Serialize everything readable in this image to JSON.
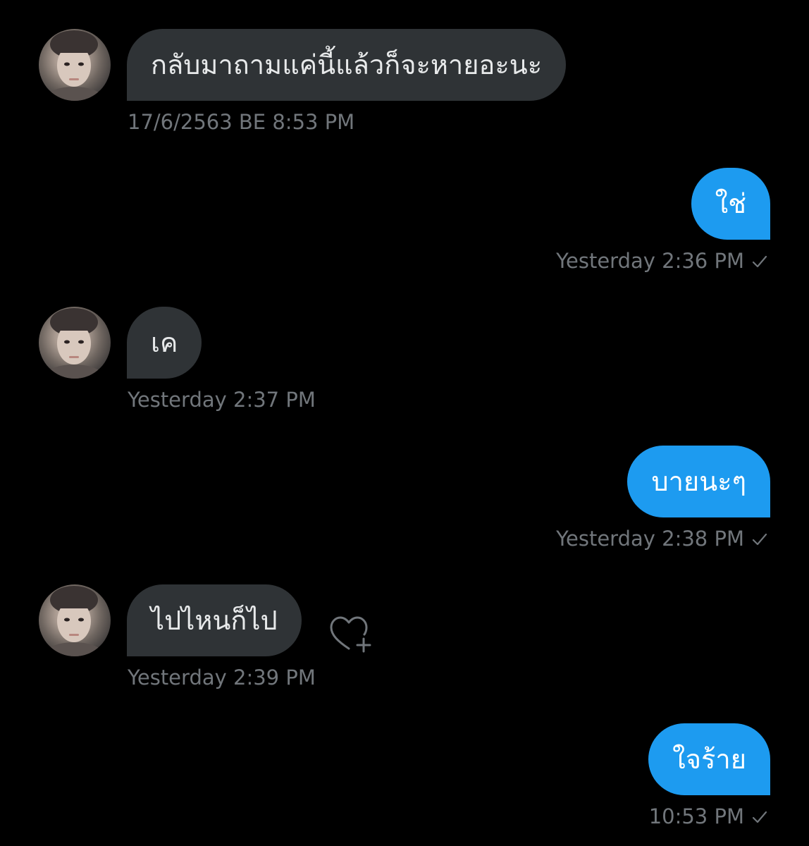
{
  "messages": [
    {
      "direction": "incoming",
      "text": "กลับมาถามแค่นี้แล้วก็จะหายอะนะ",
      "timestamp": "17/6/2563 BE 8:53 PM"
    },
    {
      "direction": "outgoing",
      "text": "ใช่",
      "timestamp": "Yesterday 2:36 PM"
    },
    {
      "direction": "incoming",
      "text": "เค",
      "timestamp": "Yesterday 2:37 PM"
    },
    {
      "direction": "outgoing",
      "text": "บายนะๆ",
      "timestamp": "Yesterday 2:38 PM"
    },
    {
      "direction": "incoming",
      "text": "ไปไหนก็ไป",
      "timestamp": "Yesterday 2:39 PM"
    },
    {
      "direction": "outgoing",
      "text": "ใจร้าย",
      "timestamp": "10:53 PM"
    }
  ],
  "icons": {
    "read_receipt": "checkmark-icon",
    "add_reaction": "heart-plus-icon"
  },
  "colors": {
    "background": "#000000",
    "incoming_bubble": "#2f3336",
    "outgoing_bubble": "#1d9bf0",
    "timestamp": "#71767b"
  }
}
